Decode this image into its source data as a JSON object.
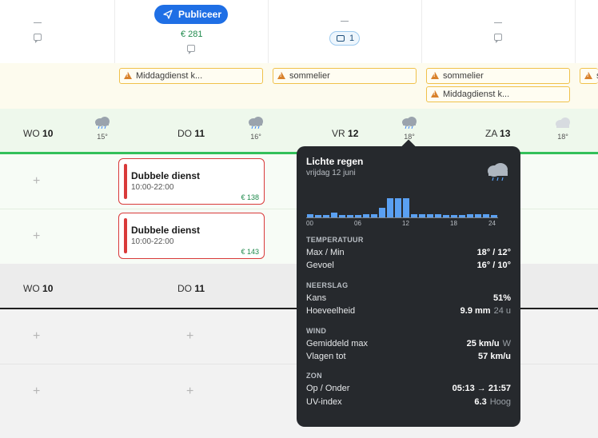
{
  "top": {
    "publish_label": "Publiceer",
    "publish_price": "€ 281",
    "comment_count": "1",
    "dash": "—"
  },
  "alerts": [
    {
      "text": "Middagdienst k..."
    },
    {
      "text": "sommelier"
    },
    {
      "text": "sommelier"
    },
    {
      "text": "Middagdienst k..."
    },
    {
      "text": "s"
    }
  ],
  "days": [
    {
      "dow": "WO",
      "num": "10",
      "temp": "15°",
      "weather": "rain-cloud-icon"
    },
    {
      "dow": "DO",
      "num": "11",
      "temp": "16°",
      "weather": "rain-cloud-icon"
    },
    {
      "dow": "VR",
      "num": "12",
      "temp": "18°",
      "weather": "rain-cloud-icon"
    },
    {
      "dow": "ZA",
      "num": "13",
      "temp": "18°",
      "weather": "cloud-icon"
    }
  ],
  "shifts": [
    {
      "title": "Dubbele dienst",
      "time": "10:00-22:00",
      "price": "€ 138"
    },
    {
      "title": "Dubbele dienst",
      "time": "10:00-22:00",
      "price": "€ 143"
    }
  ],
  "second_header": [
    {
      "dow": "WO",
      "num": "10"
    },
    {
      "dow": "DO",
      "num": "11"
    }
  ],
  "tooltip": {
    "title": "Lichte regen",
    "date": "vrijdag 12 juni",
    "hour_labels": [
      "00",
      "06",
      "12",
      "18",
      "24"
    ],
    "hourly_precip": [
      0.3,
      0.2,
      0.2,
      0.4,
      0.2,
      0.2,
      0.2,
      0.3,
      0.3,
      0.8,
      1.6,
      1.6,
      1.6,
      0.3,
      0.3,
      0.3,
      0.3,
      0.2,
      0.2,
      0.2,
      0.3,
      0.3,
      0.3,
      0.2
    ],
    "temperature": {
      "heading": "TEMPERATUUR",
      "maxmin_label": "Max / Min",
      "maxmin_value": "18° / 12°",
      "feels_label": "Gevoel",
      "feels_value": "16° / 10°"
    },
    "precip": {
      "heading": "NEERSLAG",
      "chance_label": "Kans",
      "chance_value": "51%",
      "amount_label": "Hoeveelheid",
      "amount_value": "9.9 mm",
      "amount_unit": "24 u"
    },
    "wind": {
      "heading": "WIND",
      "avg_label": "Gemiddeld max",
      "avg_value": "25 km/u",
      "avg_dir": "W",
      "gust_label": "Vlagen tot",
      "gust_value": "57 km/u"
    },
    "sun": {
      "heading": "ZON",
      "rise_label": "Op / Onder",
      "rise_value": "05:13 → 21:57",
      "uv_label": "UV-index",
      "uv_value": "6.3",
      "uv_level": "Hoog"
    }
  }
}
